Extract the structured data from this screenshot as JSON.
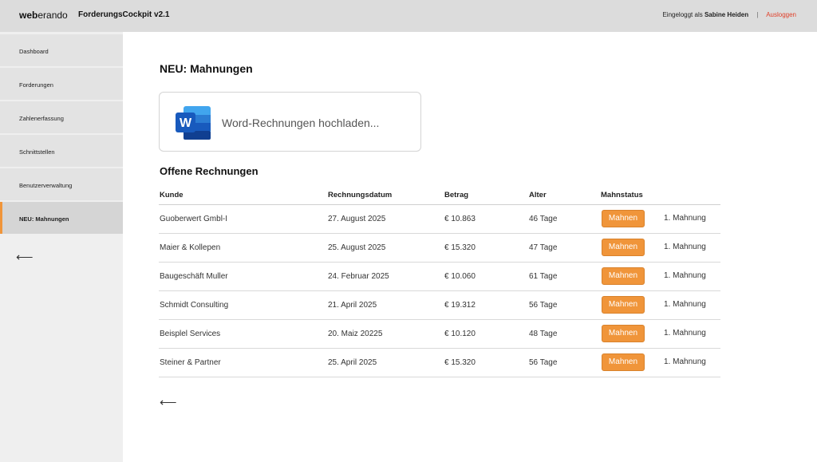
{
  "header": {
    "logo_bold": "web",
    "logo_rest": "erando",
    "app_title": "ForderungsCockpit v2.1",
    "logged_in_prefix": "Eingeloggt als",
    "user_name": "Sabine Heiden",
    "separator": "|",
    "logout_label": "Ausloggen"
  },
  "sidebar": {
    "items": [
      {
        "label": "Dashboard"
      },
      {
        "label": "Forderungen"
      },
      {
        "label": "Zahlenerfassung"
      },
      {
        "label": "Schnittstellen"
      },
      {
        "label": "Benutzerverwaltung"
      },
      {
        "label": "NEU: Mahnungen",
        "active": true
      }
    ],
    "back_icon": "arrow-left-icon"
  },
  "main": {
    "page_title": "NEU: Mahnungen",
    "upload": {
      "icon": "word-icon",
      "label": "Word-Rechnungen hochladen..."
    },
    "section_title": "Offene Rechnungen",
    "table": {
      "columns": [
        "Kunde",
        "Rechnungsdatum",
        "Betrag",
        "Alter",
        "Mahnstatus"
      ],
      "rows": [
        {
          "kunde": "Guoberwert Gmbl-I",
          "datum": "27. August 2025",
          "betrag": "€ 10.863",
          "alter": "46 Tage",
          "button": "Mahnen",
          "stufe": "1. Mahnung"
        },
        {
          "kunde": "Maier & Kollepen",
          "datum": "25. August 2025",
          "betrag": "€ 15.320",
          "alter": "47 Tage",
          "button": "Mahnen",
          "stufe": "1. Mahnung"
        },
        {
          "kunde": "Baugeschäft Muller",
          "datum": "24. Februar 2025",
          "betrag": "€ 10.060",
          "alter": "61 Tage",
          "button": "Mahnen",
          "stufe": "1. Mahnung"
        },
        {
          "kunde": "Schmidt Consulting",
          "datum": "21. April 2025",
          "betrag": "€ 19.312",
          "alter": "56 Tage",
          "button": "Mahnen",
          "stufe": "1. Mahnung"
        },
        {
          "kunde": "Beisplel Services",
          "datum": "20. Maiz 20225",
          "betrag": "€ 10.120",
          "alter": "48 Tage",
          "button": "Mahnen",
          "stufe": "1. Mahnung"
        },
        {
          "kunde": "Steiner & Partner",
          "datum": "25. April 2025",
          "betrag": "€ 15.320",
          "alter": "56 Tage",
          "button": "Mahnen",
          "stufe": "1. Mahnung"
        }
      ]
    },
    "back_icon": "arrow-left-icon"
  },
  "colors": {
    "accent": "#f0953a",
    "logout": "#e0402a",
    "topbar": "#dcdcdc",
    "sidebar": "#efefef"
  }
}
